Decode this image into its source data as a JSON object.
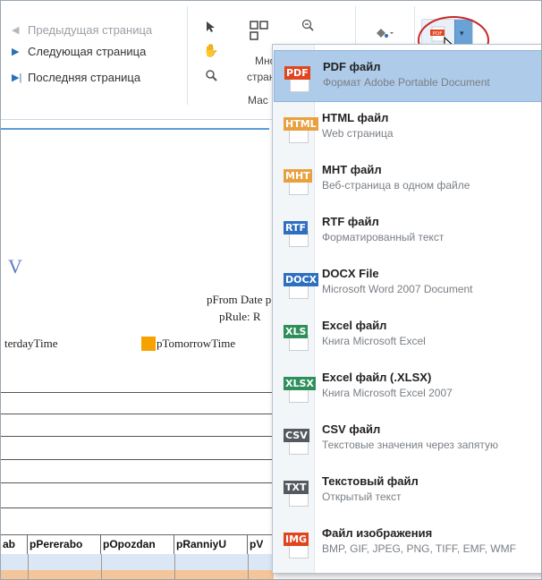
{
  "ribbon": {
    "nav": {
      "prev_label": "Предыдущая страница",
      "next_label": "Следующая страница",
      "last_label": "Последняя страница"
    },
    "partial_multi_label": "Мно",
    "partial_pages_label": "стран",
    "partial_group_label": "Мас"
  },
  "report": {
    "v_letter": "V",
    "pfrom_text": "pFrom Date p",
    "prule_text": "pRule: R",
    "yesterday_text": "terdayTime",
    "tomorrow_text": "pTomorrowTime",
    "table_headers": [
      "ab",
      "pPererabo",
      "pOpozdan",
      "pRanniyU",
      "pV"
    ]
  },
  "menu": {
    "items": [
      {
        "badge": "PDF",
        "color": "#e0451f",
        "title": "PDF файл",
        "subtitle": "Формат Adobe Portable Document",
        "highlighted": true
      },
      {
        "badge": "HTML",
        "color": "#e9a040",
        "title": "HTML файл",
        "subtitle": "Web страница",
        "highlighted": false
      },
      {
        "badge": "MHT",
        "color": "#e9a040",
        "title": "MHT файл",
        "subtitle": "Веб-страница в одном файле",
        "highlighted": false
      },
      {
        "badge": "RTF",
        "color": "#2f6fc0",
        "title": "RTF файл",
        "subtitle": "Форматированный текст",
        "highlighted": false
      },
      {
        "badge": "DOCX",
        "color": "#2f6fc0",
        "title": "DOCX File",
        "subtitle": "Microsoft Word 2007 Document",
        "highlighted": false
      },
      {
        "badge": "XLS",
        "color": "#2f8f5a",
        "title": "Excel файл",
        "subtitle": "Книга Microsoft Excel",
        "highlighted": false
      },
      {
        "badge": "XLSX",
        "color": "#2f8f5a",
        "title": "Excel файл (.XLSX)",
        "subtitle": "Книга Microsoft Excel 2007",
        "highlighted": false
      },
      {
        "badge": "CSV",
        "color": "#555a60",
        "title": "CSV файл",
        "subtitle": "Текстовые значения через запятую",
        "highlighted": false
      },
      {
        "badge": "TXT",
        "color": "#555a60",
        "title": "Текстовый файл",
        "subtitle": "Открытый текст",
        "highlighted": false
      },
      {
        "badge": "IMG",
        "color": "#e0451f",
        "title": "Файл изображения",
        "subtitle": "BMP, GIF, JPEG, PNG, TIFF, EMF, WMF",
        "highlighted": false
      }
    ]
  }
}
